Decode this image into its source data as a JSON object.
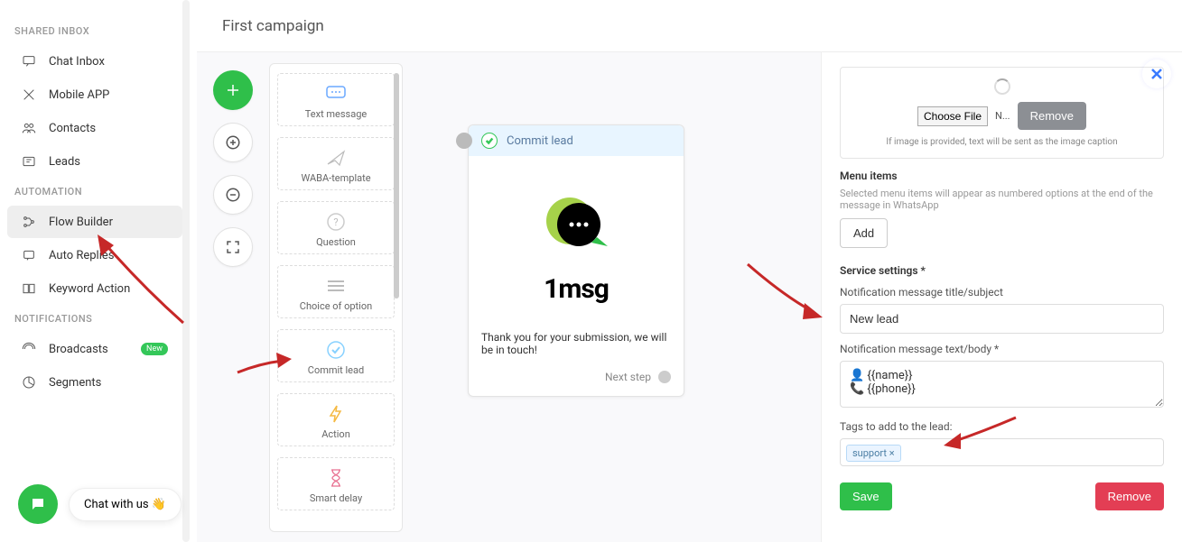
{
  "sidebar": {
    "sections": [
      {
        "title": "SHARED INBOX",
        "items": [
          "Chat Inbox",
          "Mobile APP",
          "Contacts",
          "Leads"
        ]
      },
      {
        "title": "AUTOMATION",
        "items": [
          "Flow Builder",
          "Auto Replies",
          "Keyword Action"
        ],
        "activeIndex": 0
      },
      {
        "title": "NOTIFICATIONS",
        "items": [
          "Broadcasts",
          "Segments"
        ],
        "badges": {
          "0": "New"
        }
      }
    ]
  },
  "chat_widget_label": "Chat with us",
  "canvas": {
    "title": "First campaign",
    "palette": [
      "Text message",
      "WABA-template",
      "Question",
      "Choice of option",
      "Commit lead",
      "Action",
      "Smart delay"
    ],
    "node": {
      "title": "Commit lead",
      "body": "Thank you for your submission, we will be in touch!",
      "next": "Next step",
      "logo_text": "1msg"
    }
  },
  "panel": {
    "choose_file": "Choose File",
    "no_file": "N...",
    "remove_img": "Remove",
    "caption_hint": "If image is provided, text will be sent as the image caption",
    "menu_title": "Menu items",
    "menu_hint": "Selected menu items will appear as numbered options at the end of the message in WhatsApp",
    "add": "Add",
    "service_title": "Service settings *",
    "notif_title_label": "Notification message title/subject",
    "notif_title_value": "New lead",
    "notif_body_label": "Notification message text/body *",
    "notif_body_value": "👤 {{name}}\n📞 {{phone}}",
    "tags_label": "Tags to add to the lead:",
    "tag_value": "support ×",
    "save": "Save",
    "remove": "Remove"
  }
}
